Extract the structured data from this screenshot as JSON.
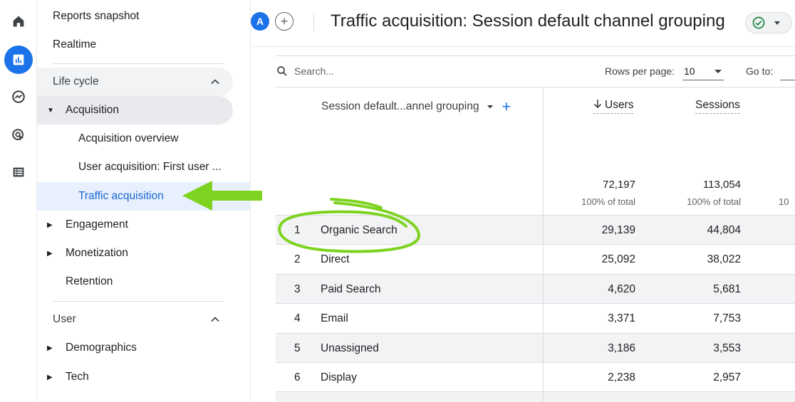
{
  "app": {
    "accent_color": "#1a73e8",
    "highlight_color": "#7ed321"
  },
  "rail": {
    "icons": [
      "home-icon",
      "reports-icon",
      "explore-icon",
      "advertising-icon",
      "configure-icon"
    ]
  },
  "sidebar": {
    "reports_snapshot": "Reports snapshot",
    "realtime": "Realtime",
    "lifecycle": {
      "label": "Life cycle",
      "acquisition": {
        "label": "Acquisition",
        "items": [
          "Acquisition overview",
          "User acquisition: First user ...",
          "Traffic acquisition"
        ]
      },
      "engagement": "Engagement",
      "monetization": "Monetization",
      "retention": "Retention"
    },
    "user": {
      "label": "User",
      "demographics": "Demographics",
      "tech": "Tech"
    }
  },
  "header": {
    "avatar_letter": "A",
    "add_symbol": "+",
    "title": "Traffic acquisition: Session default channel grouping"
  },
  "toolbar": {
    "search_placeholder": "Search...",
    "rows_per_page_label": "Rows per page:",
    "rows_per_page_value": "10",
    "goto_label": "Go to:"
  },
  "table": {
    "dimension_header": "Session default...annel grouping",
    "add_symbol": "+",
    "columns": [
      "Users",
      "Sessions"
    ],
    "totals": {
      "users": "72,197",
      "users_pct": "100% of total",
      "sessions": "113,054",
      "sessions_pct": "100% of total"
    },
    "rows": [
      {
        "idx": "1",
        "name": "Organic Search",
        "users": "29,139",
        "sessions": "44,804"
      },
      {
        "idx": "2",
        "name": "Direct",
        "users": "25,092",
        "sessions": "38,022"
      },
      {
        "idx": "3",
        "name": "Paid Search",
        "users": "4,620",
        "sessions": "5,681"
      },
      {
        "idx": "4",
        "name": "Email",
        "users": "3,371",
        "sessions": "7,753"
      },
      {
        "idx": "5",
        "name": "Unassigned",
        "users": "3,186",
        "sessions": "3,553"
      },
      {
        "idx": "6",
        "name": "Display",
        "users": "2,238",
        "sessions": "2,957"
      }
    ]
  }
}
